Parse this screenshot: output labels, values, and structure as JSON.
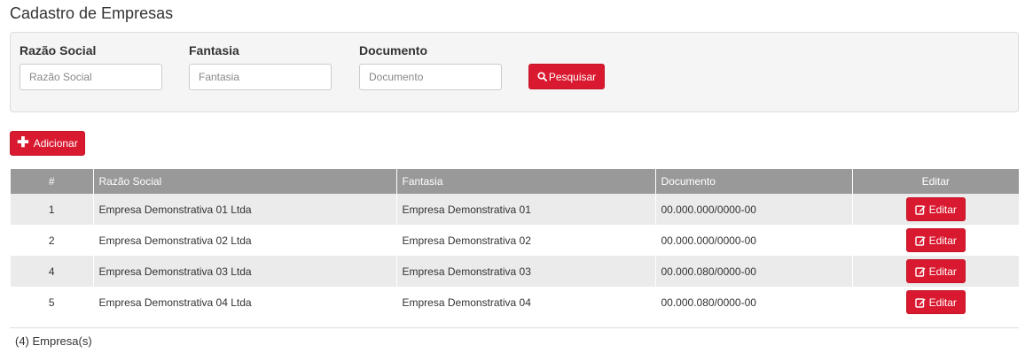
{
  "page": {
    "title": "Cadastro de Empresas"
  },
  "filters": {
    "fields": [
      {
        "label": "Razão Social",
        "placeholder": "Razão Social",
        "value": ""
      },
      {
        "label": "Fantasia",
        "placeholder": "Fantasia",
        "value": ""
      },
      {
        "label": "Documento",
        "placeholder": "Documento",
        "value": ""
      }
    ],
    "search_label": "Pesquisar",
    "search_icon": "search-icon"
  },
  "toolbar": {
    "add_label": "Adicionar",
    "add_icon": "plus-icon"
  },
  "table": {
    "headers": [
      "#",
      "Razão Social",
      "Fantasia",
      "Documento",
      "Editar"
    ],
    "rows": [
      {
        "id": "1",
        "razao": "Empresa Demonstrativa 01 Ltda",
        "fantasia": "Empresa Demonstrativa 01",
        "documento": "00.000.000/0000-00",
        "edit_label": "Editar"
      },
      {
        "id": "2",
        "razao": "Empresa Demonstrativa 02 Ltda",
        "fantasia": "Empresa Demonstrativa 02",
        "documento": "00.000.000/0000-00",
        "edit_label": "Editar"
      },
      {
        "id": "4",
        "razao": "Empresa Demonstrativa 03 Ltda",
        "fantasia": "Empresa Demonstrativa 03",
        "documento": "00.000.080/0000-00",
        "edit_label": "Editar"
      },
      {
        "id": "5",
        "razao": "Empresa Demonstrativa 04 Ltda",
        "fantasia": "Empresa Demonstrativa 04",
        "documento": "00.000.080/0000-00",
        "edit_label": "Editar"
      }
    ],
    "edit_icon": "edit-icon"
  },
  "footer": {
    "count_text": "(4) Empresa(s)"
  },
  "colors": {
    "accent": "#d9192f",
    "header_bg": "#999999",
    "row_alt": "#ebebeb"
  }
}
